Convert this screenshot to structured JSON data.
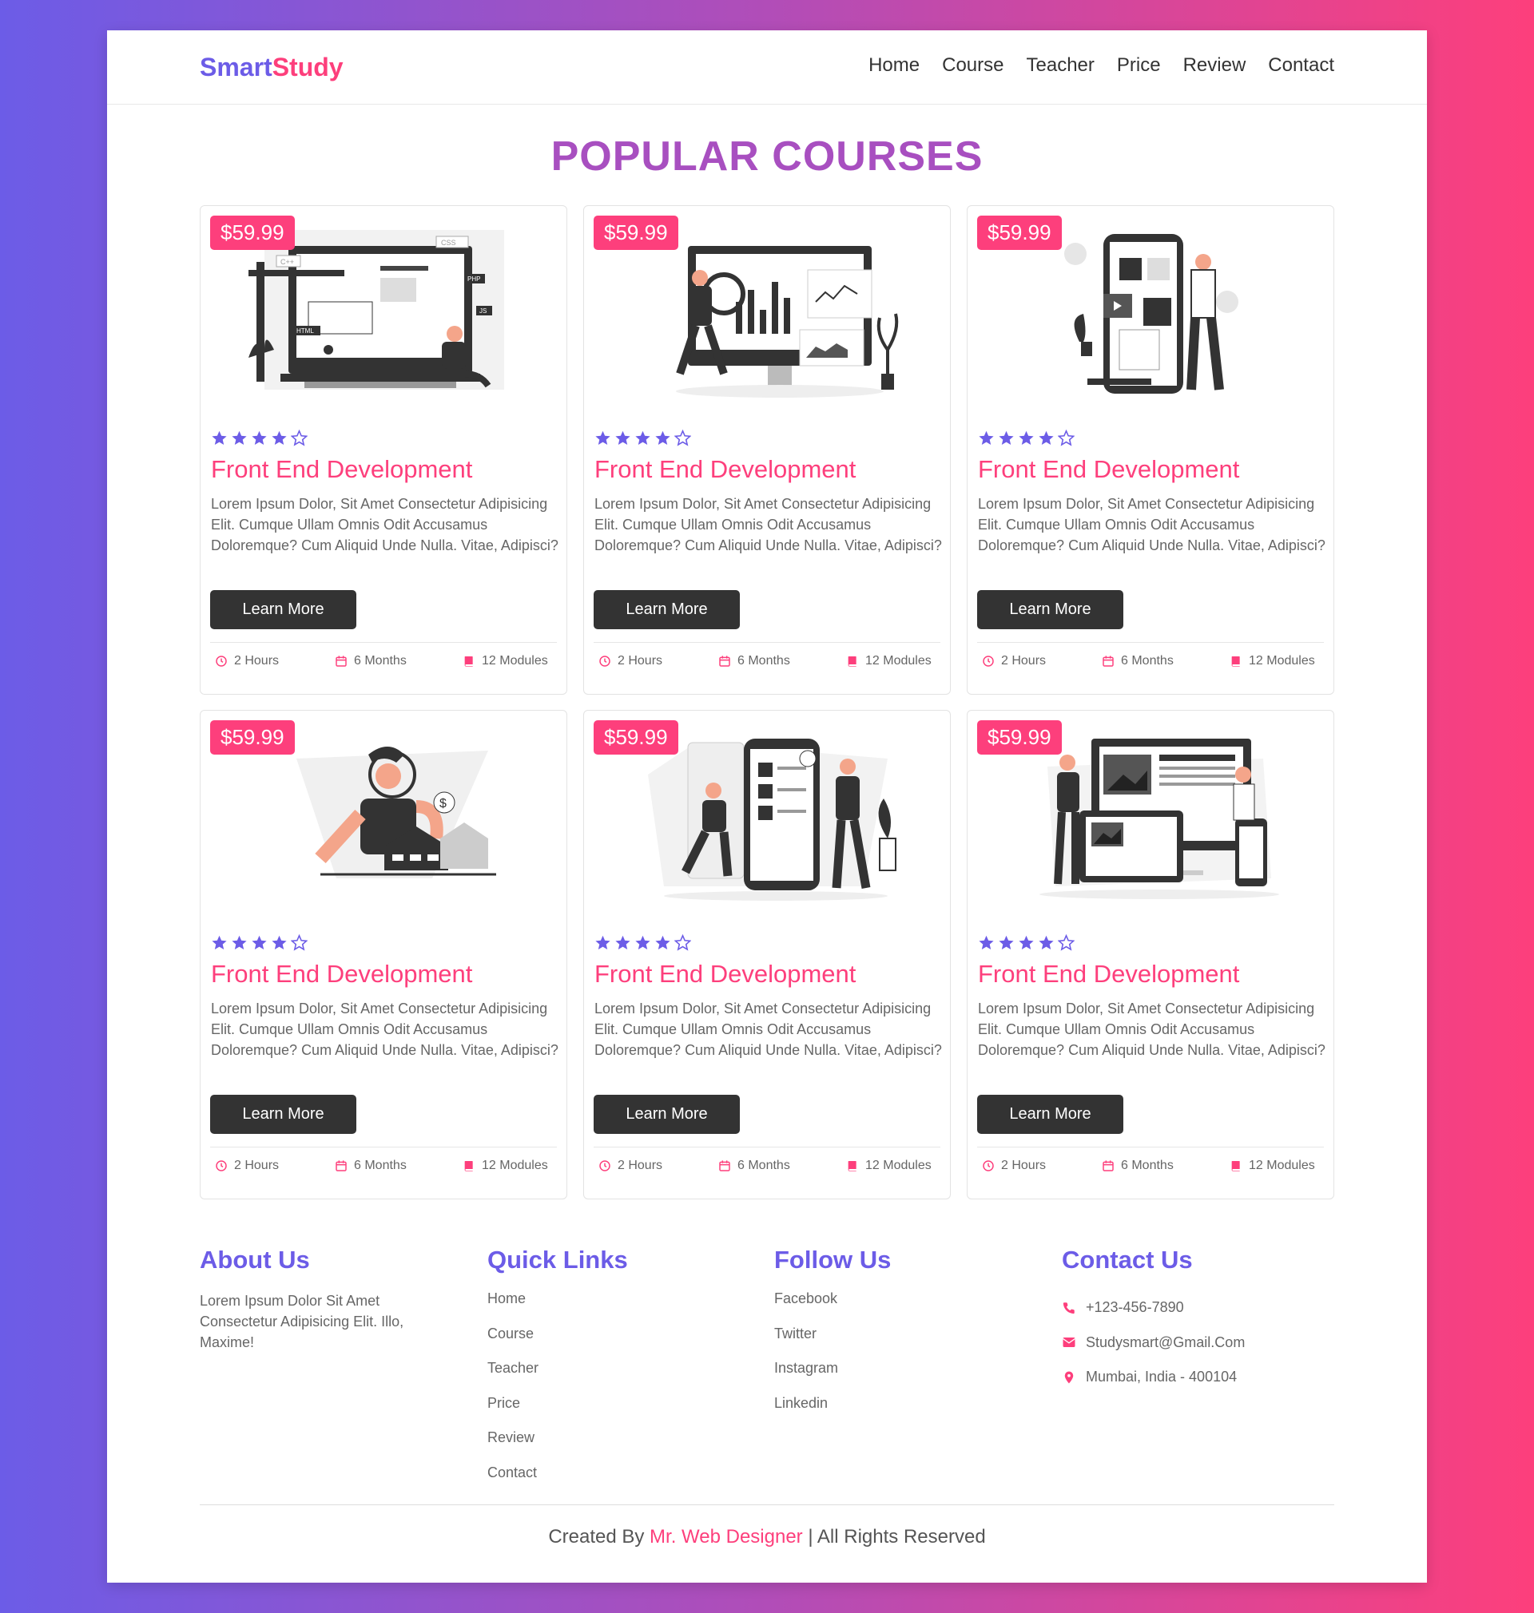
{
  "brand": {
    "part1": "Smart",
    "part2": "Study"
  },
  "nav": [
    "Home",
    "Course",
    "Teacher",
    "Price",
    "Review",
    "Contact"
  ],
  "section_title": "POPULAR COURSES",
  "colors": {
    "purple": "#6c5ce7",
    "pink": "#fd3f7c",
    "dark": "#333333"
  },
  "courses": [
    {
      "price": "$59.99",
      "rating": 4,
      "title": "Front End Development",
      "desc": "Lorem Ipsum Dolor, Sit Amet Consectetur Adipisicing Elit. Cumque Ullam Omnis Odit Accusamus Doloremque? Cum Aliquid Unde Nulla. Vitae, Adipisci?",
      "button": "Learn More",
      "hours": "2 Hours",
      "months": "6 Months",
      "modules": "12 Modules",
      "illus_labels": [
        "HTML",
        "CSS",
        "C++",
        "PHP",
        "JS"
      ]
    },
    {
      "price": "$59.99",
      "rating": 4,
      "title": "Front End Development",
      "desc": "Lorem Ipsum Dolor, Sit Amet Consectetur Adipisicing Elit. Cumque Ullam Omnis Odit Accusamus Doloremque? Cum Aliquid Unde Nulla. Vitae, Adipisci?",
      "button": "Learn More",
      "hours": "2 Hours",
      "months": "6 Months",
      "modules": "12 Modules"
    },
    {
      "price": "$59.99",
      "rating": 4,
      "title": "Front End Development",
      "desc": "Lorem Ipsum Dolor, Sit Amet Consectetur Adipisicing Elit. Cumque Ullam Omnis Odit Accusamus Doloremque? Cum Aliquid Unde Nulla. Vitae, Adipisci?",
      "button": "Learn More",
      "hours": "2 Hours",
      "months": "6 Months",
      "modules": "12 Modules"
    },
    {
      "price": "$59.99",
      "rating": 4,
      "title": "Front End Development",
      "desc": "Lorem Ipsum Dolor, Sit Amet Consectetur Adipisicing Elit. Cumque Ullam Omnis Odit Accusamus Doloremque? Cum Aliquid Unde Nulla. Vitae, Adipisci?",
      "button": "Learn More",
      "hours": "2 Hours",
      "months": "6 Months",
      "modules": "12 Modules",
      "illus_labels": [
        "$"
      ]
    },
    {
      "price": "$59.99",
      "rating": 4,
      "title": "Front End Development",
      "desc": "Lorem Ipsum Dolor, Sit Amet Consectetur Adipisicing Elit. Cumque Ullam Omnis Odit Accusamus Doloremque? Cum Aliquid Unde Nulla. Vitae, Adipisci?",
      "button": "Learn More",
      "hours": "2 Hours",
      "months": "6 Months",
      "modules": "12 Modules"
    },
    {
      "price": "$59.99",
      "rating": 4,
      "title": "Front End Development",
      "desc": "Lorem Ipsum Dolor, Sit Amet Consectetur Adipisicing Elit. Cumque Ullam Omnis Odit Accusamus Doloremque? Cum Aliquid Unde Nulla. Vitae, Adipisci?",
      "button": "Learn More",
      "hours": "2 Hours",
      "months": "6 Months",
      "modules": "12 Modules"
    }
  ],
  "footer": {
    "about": {
      "title": "About Us",
      "text": "Lorem Ipsum Dolor Sit Amet Consectetur Adipisicing Elit. Illo, Maxime!"
    },
    "quick": {
      "title": "Quick Links",
      "links": [
        "Home",
        "Course",
        "Teacher",
        "Price",
        "Review",
        "Contact"
      ]
    },
    "follow": {
      "title": "Follow Us",
      "links": [
        "Facebook",
        "Twitter",
        "Instagram",
        "Linkedin"
      ]
    },
    "contact": {
      "title": "Contact Us",
      "phone": "+123-456-7890",
      "email": "Studysmart@Gmail.Com",
      "address": "Mumbai, India - 400104"
    }
  },
  "credit": {
    "prefix": "Created By ",
    "author": "Mr. Web Designer",
    "suffix": " | All Rights Reserved"
  },
  "icons": {
    "star": "star-icon",
    "clock": "clock-icon",
    "calendar": "calendar-icon",
    "book": "book-icon",
    "phone": "phone-icon",
    "envelope": "envelope-icon",
    "marker": "map-marker-icon"
  }
}
